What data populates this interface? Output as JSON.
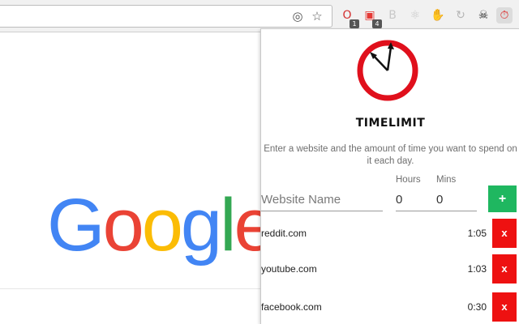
{
  "extensions": [
    {
      "name": "lastpass-icon",
      "glyph": "O",
      "badge": "1",
      "color": "#d32f2f"
    },
    {
      "name": "calendar-icon",
      "glyph": "▣",
      "badge": "4",
      "color": "#e53935"
    },
    {
      "name": "b-extension-icon",
      "glyph": "B",
      "color": "#c8c8c8"
    },
    {
      "name": "react-icon",
      "glyph": "⚛",
      "color": "#c8c8c8"
    },
    {
      "name": "hand-icon",
      "glyph": "✋",
      "color": "#b5b5b5"
    },
    {
      "name": "refresh-icon",
      "glyph": "↻",
      "color": "#b5b5b5"
    },
    {
      "name": "pirate-icon",
      "glyph": "☠",
      "color": "#222222"
    },
    {
      "name": "timelimit-icon",
      "glyph": "⏱",
      "color": "#dd2222"
    }
  ],
  "google": [
    "G",
    "o",
    "o",
    "g",
    "l",
    "e"
  ],
  "google_colors": [
    "#4285F4",
    "#EA4335",
    "#FBBC05",
    "#4285F4",
    "#34A853",
    "#EA4335"
  ],
  "popup": {
    "brand": "TIMELIMIT",
    "description": "Enter a website and the amount of time you want to spend on it each day.",
    "hours_label": "Hours",
    "mins_label": "Mins",
    "website_placeholder": "Website Name",
    "hours_value": "0",
    "mins_value": "0",
    "add_label": "+",
    "delete_label": "x",
    "sites": [
      {
        "site": "reddit.com",
        "time": "1:05"
      },
      {
        "site": "youtube.com",
        "time": "1:03"
      },
      {
        "site": "facebook.com",
        "time": "0:30"
      }
    ]
  },
  "colors": {
    "add": "#1fb760",
    "delete": "#ee1111",
    "clock_ring": "#e0101c"
  }
}
